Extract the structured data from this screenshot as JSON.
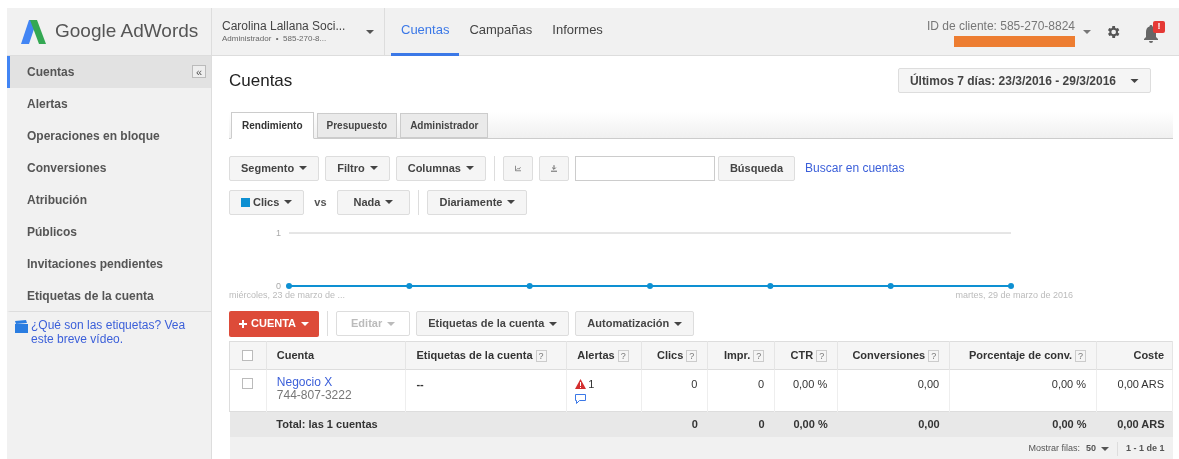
{
  "header": {
    "product": "Google AdWords",
    "account_name": "Carolina Lallana Soci...",
    "account_sub": "Administrador  •  585-270-8...",
    "nav": [
      {
        "label": "Cuentas",
        "selected": true
      },
      {
        "label": "Campañas",
        "selected": false
      },
      {
        "label": "Informes",
        "selected": false
      }
    ],
    "client_id": "ID de cliente: 585-270-8824",
    "notification_badge": "!"
  },
  "sidebar": {
    "collapse": "«",
    "items": [
      {
        "label": "Cuentas",
        "selected": true
      },
      {
        "label": "Alertas",
        "selected": false
      },
      {
        "label": "Operaciones en bloque",
        "selected": false
      },
      {
        "label": "Conversiones",
        "selected": false
      },
      {
        "label": "Atribución",
        "selected": false
      },
      {
        "label": "Públicos",
        "selected": false
      },
      {
        "label": "Invitaciones pendientes",
        "selected": false
      },
      {
        "label": "Etiquetas de la cuenta",
        "selected": false
      }
    ],
    "help_link": "¿Qué son las etiquetas? Vea este breve vídeo."
  },
  "page_title": "Cuentas",
  "date_range": "Últimos 7 días: 23/3/2016 - 29/3/2016",
  "tabs": [
    {
      "label": "Rendimiento",
      "selected": true
    },
    {
      "label": "Presupuesto",
      "selected": false
    },
    {
      "label": "Administrador",
      "selected": false
    }
  ],
  "toolbar": {
    "buttons": [
      "Segmento",
      "Filtro",
      "Columnas"
    ],
    "search_button": "Búsqueda",
    "search_link": "Buscar en cuentas",
    "vs": "vs",
    "compare": "Nada",
    "interval": "Diariamente"
  },
  "chart_data": {
    "type": "line",
    "ylim": [
      0,
      1
    ],
    "yticks": [
      0,
      1
    ],
    "categories": [
      "miércoles, 23 de marzo de ...",
      null,
      null,
      null,
      null,
      null,
      "martes, 29 de marzo de 2016"
    ],
    "series": [
      {
        "name": "Clics",
        "color": "#0e90d2",
        "marker": "circle",
        "values": [
          0,
          0,
          0,
          0,
          0,
          0,
          0
        ]
      }
    ]
  },
  "actions": [
    {
      "label": "CUENTA",
      "kind": "primary",
      "disabled": false
    },
    {
      "label": "Editar",
      "kind": "menu",
      "disabled": true
    },
    {
      "label": "Etiquetas de la cuenta",
      "kind": "menu",
      "disabled": false
    },
    {
      "label": "Automatización",
      "kind": "menu",
      "disabled": false
    }
  ],
  "table": {
    "select_all_checked": false,
    "columns": [
      {
        "label": "Cuenta"
      },
      {
        "label": "Etiquetas de la cuenta",
        "help": "?"
      },
      {
        "label": "Alertas",
        "help": "?"
      },
      {
        "label": "Clics",
        "help": "?"
      },
      {
        "label": "Impr.",
        "help": "?"
      },
      {
        "label": "CTR",
        "help": "?"
      },
      {
        "label": "Conversiones",
        "help": "?"
      },
      {
        "label": "Porcentaje de conv.",
        "help": "?"
      },
      {
        "label": "Coste"
      }
    ],
    "rows": [
      {
        "checked": false,
        "name": "Negocio X",
        "id": "744-807-3222",
        "labels": "--",
        "alerts": "1",
        "clics": "0",
        "impr": "0",
        "ctr": "0,00 %",
        "conversions": "0,00",
        "conv_rate": "0,00 %",
        "cost": "0,00 ARS"
      }
    ],
    "total": {
      "label": "Total: las 1 cuentas",
      "clics": "0",
      "impr": "0",
      "ctr": "0,00 %",
      "conversions": "0,00",
      "conv_rate": "0,00 %",
      "cost": "0,00 ARS"
    },
    "rows_label": "Mostrar filas:",
    "rows_value": "50",
    "pagination": "1 - 1 de 1"
  }
}
